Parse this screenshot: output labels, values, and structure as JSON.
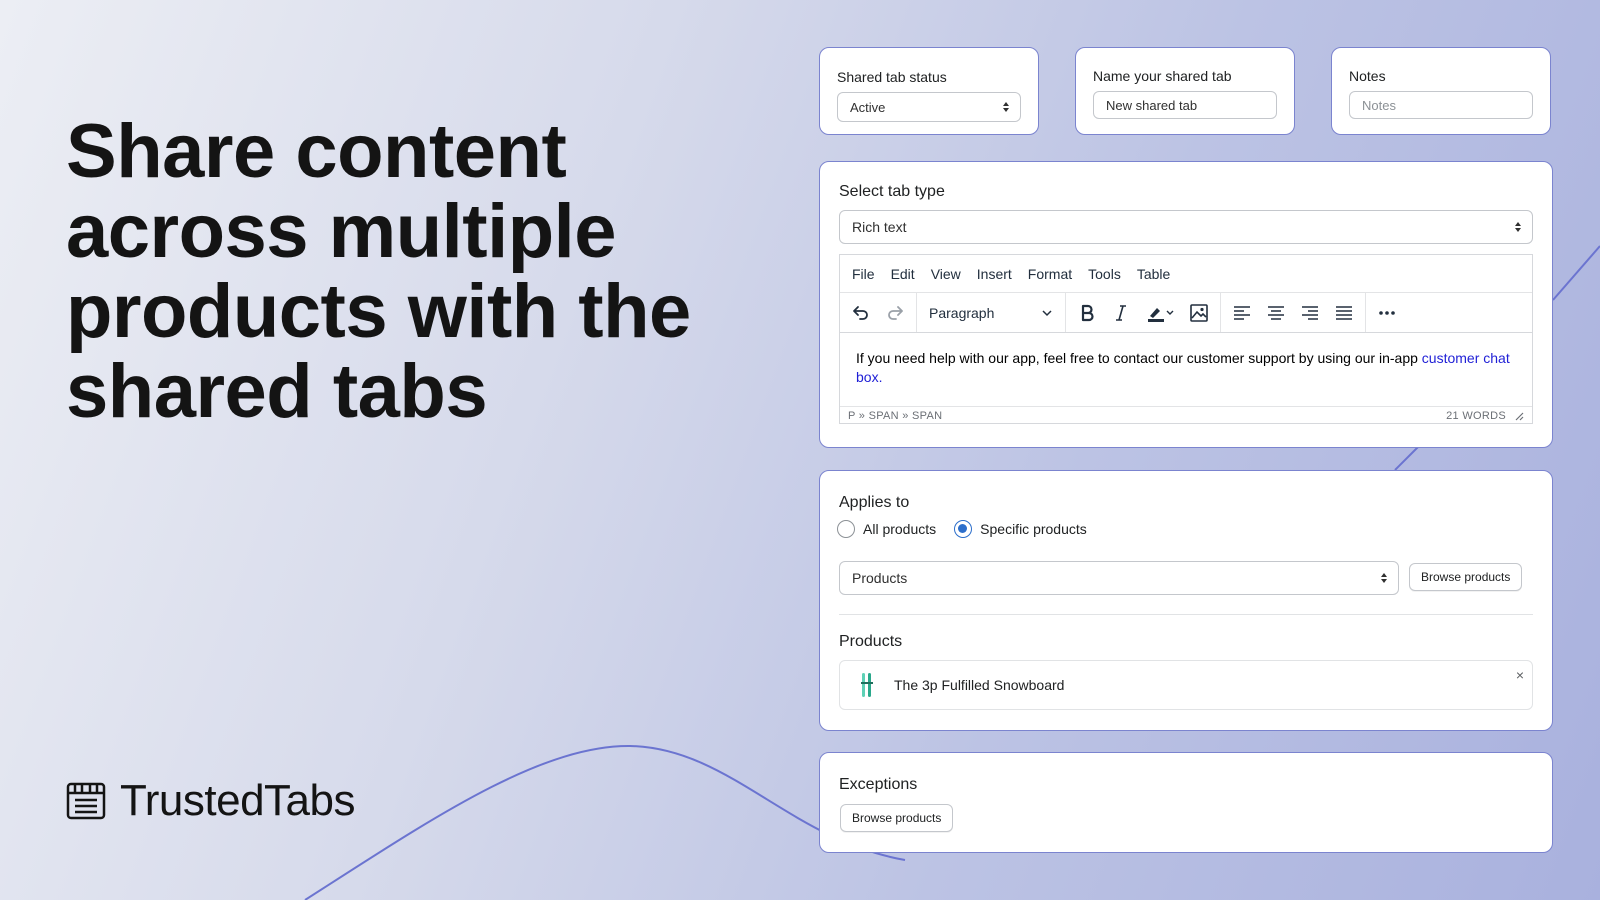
{
  "hero": {
    "bold": "Share content",
    "rest": " across multiple products with the shared tabs"
  },
  "brand": {
    "name": "TrustedTabs",
    "icon": "newspaper-icon"
  },
  "status_card": {
    "label": "Shared tab status",
    "value": "Active"
  },
  "name_card": {
    "label": "Name your shared tab",
    "value": "New shared tab"
  },
  "notes_card": {
    "label": "Notes",
    "placeholder": "Notes"
  },
  "tab_type": {
    "label": "Select tab type",
    "value": "Rich text",
    "editor": {
      "menu": [
        "File",
        "Edit",
        "View",
        "Insert",
        "Format",
        "Tools",
        "Table"
      ],
      "block_format": "Paragraph",
      "content_text": "If you need help with our app, feel free to contact our customer support by using our in-app ",
      "content_link": "customer chat box.",
      "path": "P » SPAN » SPAN",
      "word_count": "21 WORDS"
    }
  },
  "applies": {
    "label": "Applies to",
    "options": [
      "All products",
      "Specific products"
    ],
    "selected": "Specific products",
    "select_value": "Products",
    "browse_label": "Browse products",
    "products_heading": "Products",
    "products": [
      {
        "name": "The 3p Fulfilled Snowboard"
      }
    ],
    "remove_glyph": "×"
  },
  "exceptions": {
    "label": "Exceptions",
    "browse_label": "Browse products"
  },
  "colors": {
    "accent": "#2c6ecb",
    "card_border": "#7b84cf",
    "link": "#1f1fd6",
    "deco_line": "#6b74d0"
  }
}
